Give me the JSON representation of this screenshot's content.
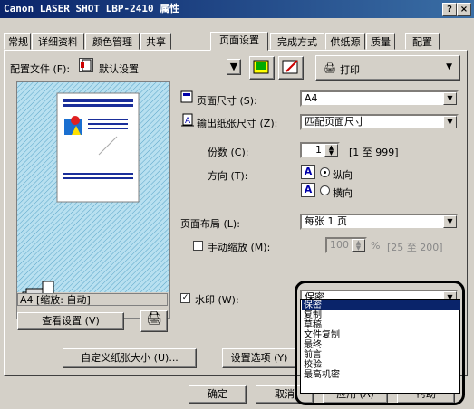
{
  "window": {
    "title": "Canon LASER SHOT LBP-2410 属性",
    "help_btn": "?",
    "close_btn": "×"
  },
  "tabs": [
    "常规",
    "详细资料",
    "颜色管理",
    "共享",
    "页面设置",
    "完成方式",
    "供纸源",
    "质量",
    "配置"
  ],
  "profile": {
    "label": "配置文件 (F):",
    "value": "默认设置",
    "print_label": "打印"
  },
  "page_size": {
    "label": "页面尺寸 (S):",
    "value": "A4"
  },
  "output_size": {
    "label": "输出纸张尺寸 (Z):",
    "value": "匹配页面尺寸"
  },
  "copies": {
    "label": "份数 (C):",
    "value": "1",
    "range": "[1 至 999]"
  },
  "orientation": {
    "label": "方向 (T):",
    "portrait": "纵向",
    "landscape": "横向"
  },
  "layout": {
    "label": "页面布局 (L):",
    "value": "每张 1 页"
  },
  "manual_scale": {
    "label": "手动缩放 (M):",
    "value": "100",
    "unit": "%",
    "range": "[25 至 200]"
  },
  "preview_caption": "A4 [缩放: 自动]",
  "view_settings_btn": "查看设置 (V)",
  "watermark": {
    "label": "水印 (W):",
    "value": "保密",
    "options": [
      "保密",
      "复制",
      "草稿",
      "文件复制",
      "最终",
      "前言",
      "校验",
      "最高机密"
    ]
  },
  "custom_size_btn": "自定义纸张大小 (U)...",
  "settings_options_btn": "设置选项 (Y)",
  "bottom": {
    "ok": "确定",
    "cancel": "取消",
    "apply": "应用 (A)",
    "help": "帮助"
  }
}
